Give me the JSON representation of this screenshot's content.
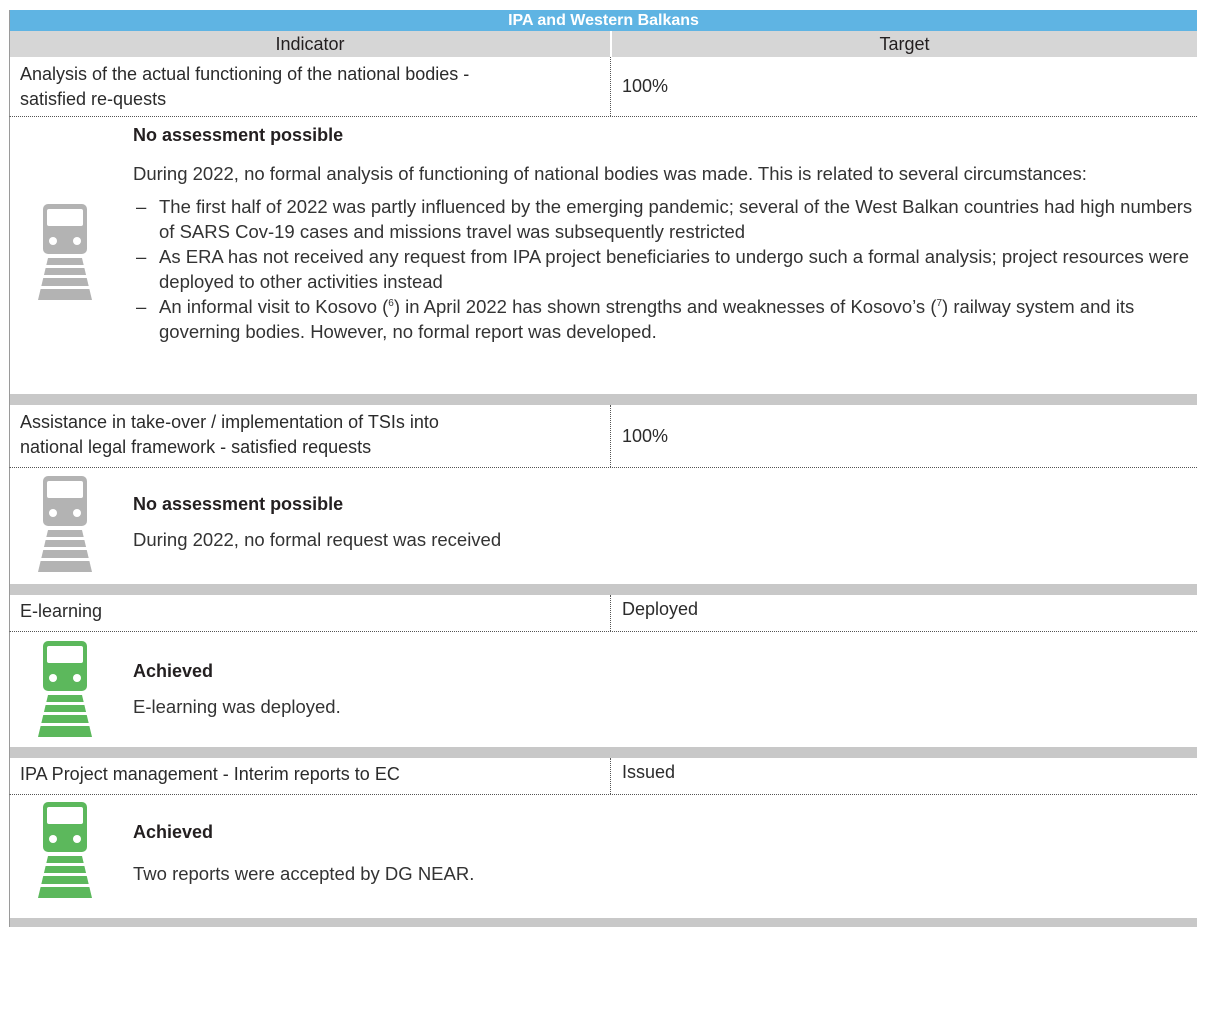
{
  "table": {
    "title": "IPA and Western Balkans",
    "header": {
      "indicator": "Indicator",
      "target": "Target"
    },
    "rows": [
      {
        "indicator_line1": "Analysis of the actual functioning of the national bodies -",
        "indicator_line2": "satisfied re-quests",
        "target": "100%",
        "status": "No assessment possible",
        "status_color": "#b3b3b3",
        "text": "During 2022, no formal analysis of functioning of national bodies was made. This is related to several circumstances:",
        "bullets": [
          {
            "dash": "–",
            "text": "The first half of 2022 was partly influenced by the emerging pandemic; several of the West Balkan countries had high numbers of SARS Cov-19 cases and missions travel was subsequently restricted"
          },
          {
            "dash": "–",
            "text": "As ERA has not received any request from IPA project beneficiaries to undergo such a formal analysis; project resources were deployed to other activities instead"
          },
          {
            "dash": "–",
            "pre": "An informal visit to Kosovo (",
            "fn1": "6",
            "mid": ") in April 2022 has shown strengths and weaknesses of Kosovo’s (",
            "fn2": "7",
            "post": ") railway system and its governing bodies. However, no formal report was developed."
          }
        ]
      },
      {
        "indicator_line1": "Assistance in take-over / implementation of TSIs into",
        "indicator_line2": "national legal framework - satisfied requests",
        "target": "100%",
        "status": "No assessment possible",
        "status_color": "#b3b3b3",
        "text": "During 2022, no formal request was received"
      },
      {
        "indicator_line1": "E-learning",
        "target": "Deployed",
        "status": "Achieved",
        "status_color": "#5cb85c",
        "text": "E-learning was deployed."
      },
      {
        "indicator_line1": "IPA Project management - Interim reports to EC",
        "target": "Issued",
        "status": "Achieved",
        "status_color": "#5cb85c",
        "text": "Two reports were accepted by DG NEAR."
      }
    ]
  }
}
